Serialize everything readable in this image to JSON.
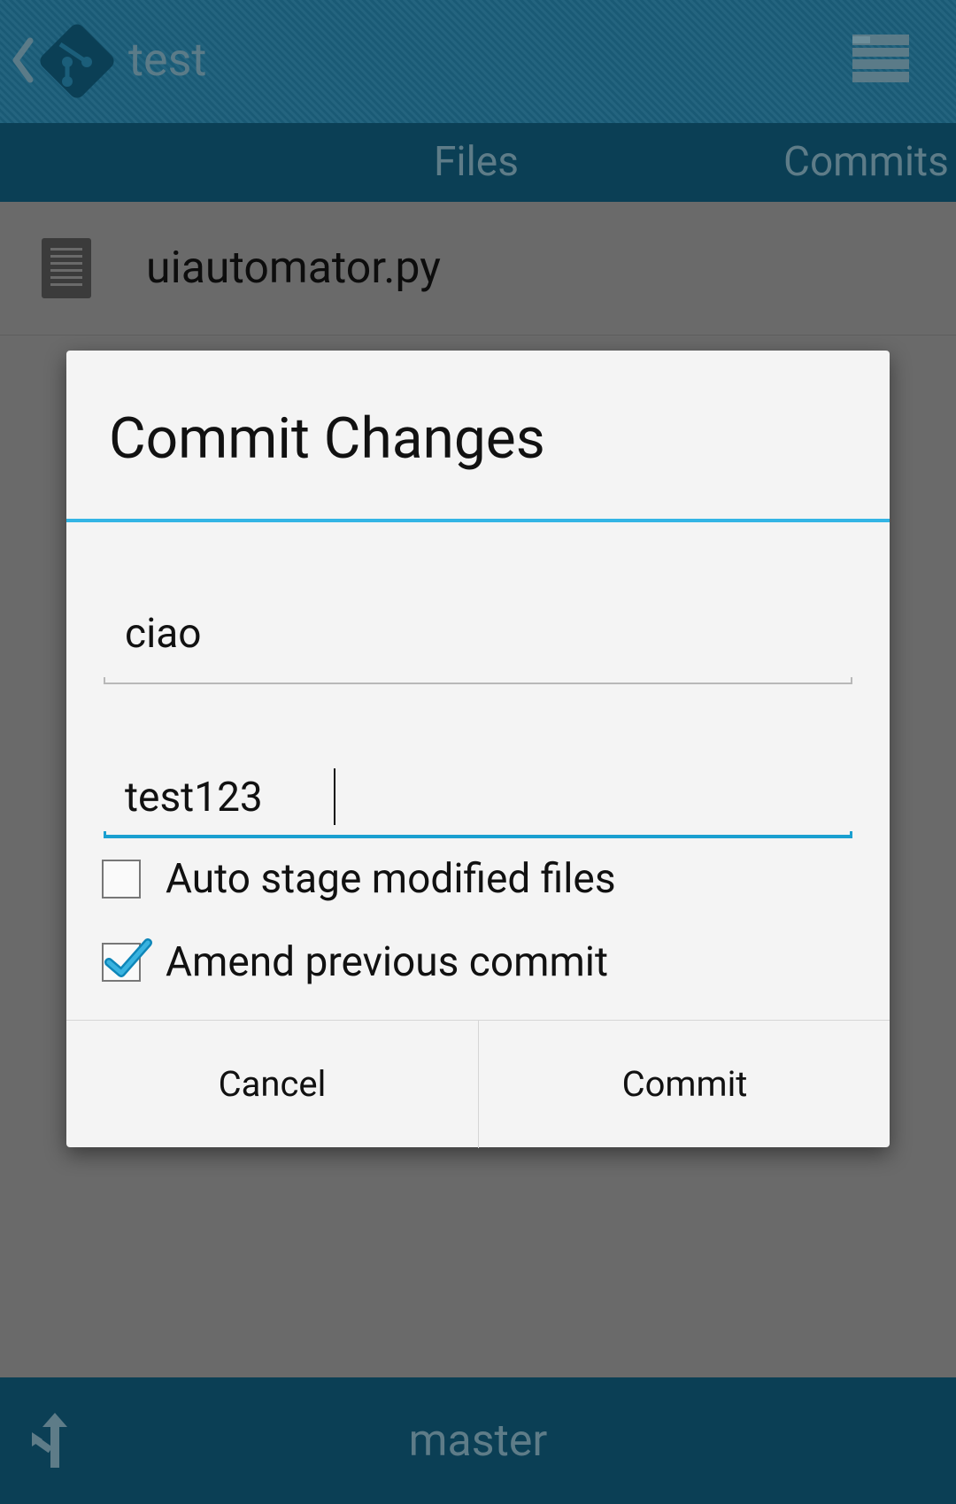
{
  "app": {
    "title": "test"
  },
  "tabs": [
    {
      "label": "Files"
    },
    {
      "label": "Commits"
    }
  ],
  "files": [
    {
      "name": "uiautomator.py"
    }
  ],
  "bottom_bar": {
    "branch": "master"
  },
  "dialog": {
    "title": "Commit Changes",
    "author_value": "ciao",
    "message_value": "test123",
    "checkboxes": [
      {
        "label": "Auto stage modified files",
        "checked": false
      },
      {
        "label": "Amend previous commit",
        "checked": true
      }
    ],
    "cancel_label": "Cancel",
    "commit_label": "Commit"
  },
  "icons": {
    "back": "chevron-left-icon",
    "logo": "git-logo-icon",
    "menu": "menu-list-icon",
    "file": "document-icon",
    "branch": "branch-icon",
    "check": "checkmark-icon"
  },
  "colors": {
    "action_bar": "#1b5e7a",
    "tab_bar": "#0b3f55",
    "accent": "#33b5e5",
    "dialog_bg": "#f4f4f4",
    "dim_overlay": "#6a6a6a"
  }
}
